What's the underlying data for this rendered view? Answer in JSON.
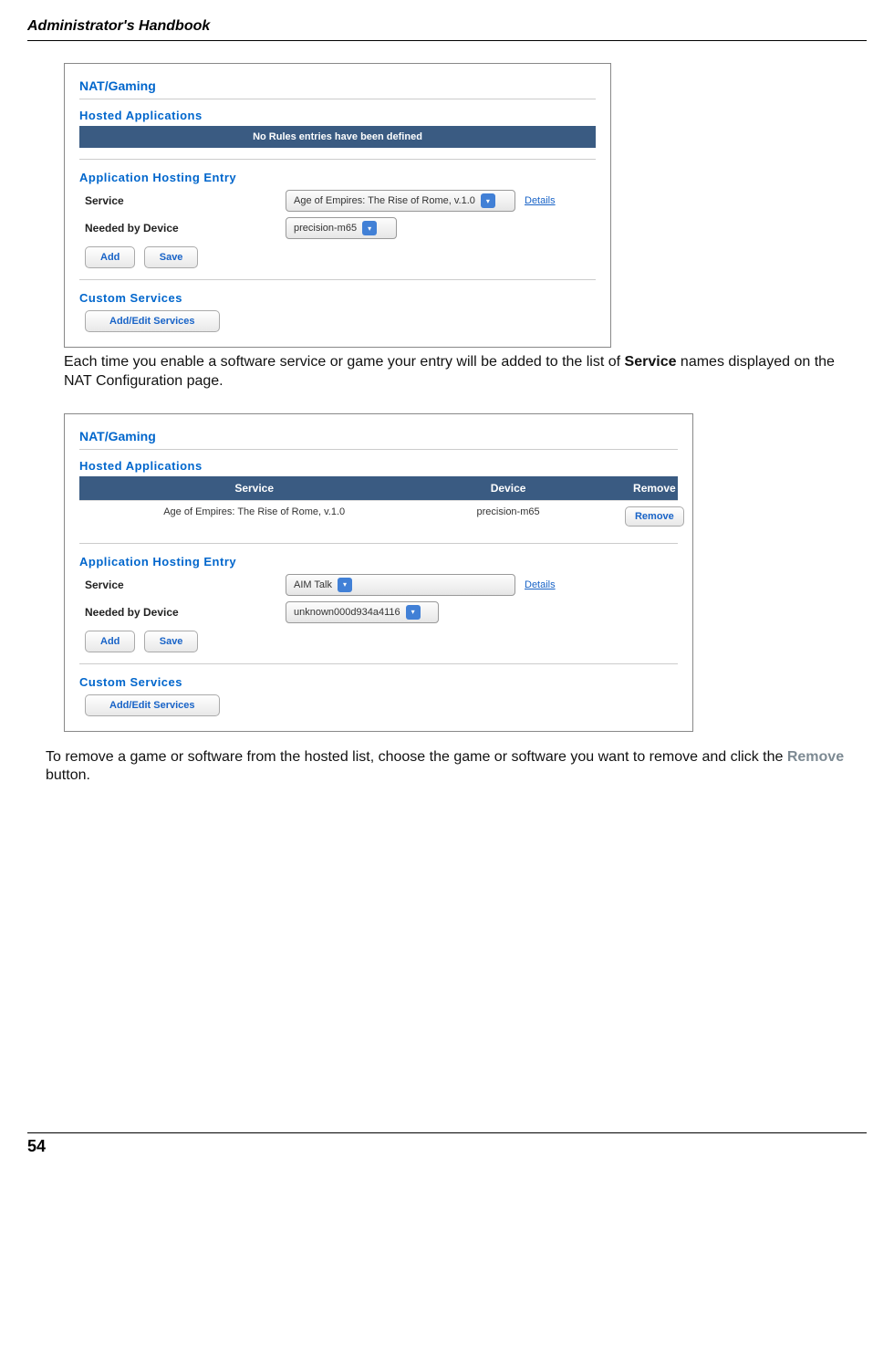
{
  "header": {
    "title": "Administrator's Handbook"
  },
  "screenshot1": {
    "nat_title": "NAT/Gaming",
    "hosted_title": "Hosted Applications",
    "no_rules": "No Rules entries have been defined",
    "entry_title": "Application Hosting Entry",
    "service_label": "Service",
    "service_value": "Age of Empires: The Rise of Rome, v.1.0",
    "details": "Details",
    "device_label": "Needed by Device",
    "device_value": "precision-m65",
    "add": "Add",
    "save": "Save",
    "custom_title": "Custom Services",
    "addedit": "Add/Edit Services"
  },
  "para1_a": "Each time you enable a software service or game your entry will be added to the list of ",
  "para1_b": "Service",
  "para1_c": " names displayed on the NAT Configuration page.",
  "screenshot2": {
    "nat_title": "NAT/Gaming",
    "hosted_title": "Hosted Applications",
    "col_service": "Service",
    "col_device": "Device",
    "col_remove": "Remove",
    "row_service": "Age of Empires: The Rise of Rome, v.1.0",
    "row_device": "precision-m65",
    "row_remove_btn": "Remove",
    "entry_title": "Application Hosting Entry",
    "service_label": "Service",
    "service_value": "AIM Talk",
    "details": "Details",
    "device_label": "Needed by Device",
    "device_value": "unknown000d934a4116",
    "add": "Add",
    "save": "Save",
    "custom_title": "Custom Services",
    "addedit": "Add/Edit Services"
  },
  "para2_a": "To remove a game or software from the hosted list, choose the game or software you want to remove and click the ",
  "para2_b": "Remove",
  "para2_c": " button.",
  "page_number": "54"
}
